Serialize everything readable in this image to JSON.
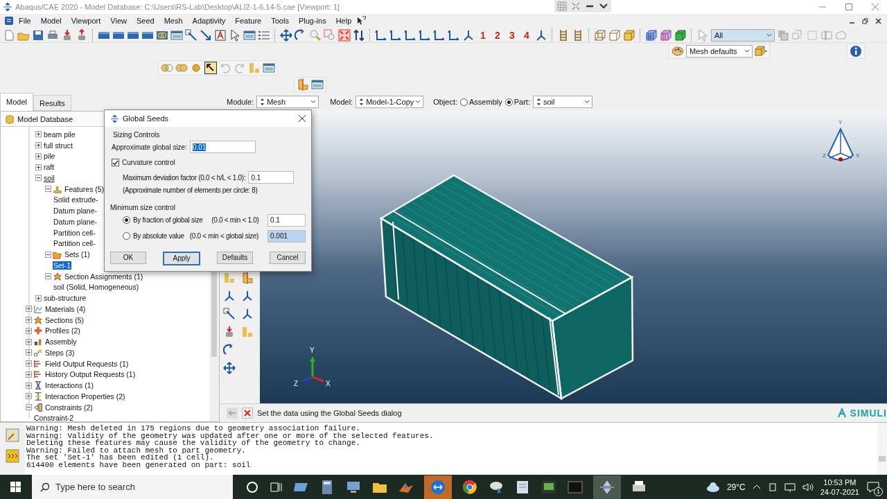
{
  "window": {
    "title": "Abaqus/CAE 2020 - Model Database: C:\\Users\\RS-Lab\\Desktop\\ALI2-1-6.14-5.cae [Viewport: 1]"
  },
  "menu": [
    "File",
    "Model",
    "Viewport",
    "View",
    "Seed",
    "Mesh",
    "Adaptivity",
    "Feature",
    "Tools",
    "Plug-ins",
    "Help"
  ],
  "toolbar": {
    "view_numbers": [
      "1",
      "2",
      "3",
      "4"
    ],
    "selection_filter": "All",
    "render_style": "Mesh defaults"
  },
  "tabs": [
    {
      "label": "Model",
      "selected": true
    },
    {
      "label": "Results",
      "selected": false
    }
  ],
  "context": {
    "module_label": "Module:",
    "module": "Mesh",
    "model_label": "Model:",
    "model": "Model-1-Copy",
    "object_label": "Object:",
    "objects": [
      {
        "label": "Assembly",
        "selected": false
      },
      {
        "label": "Part:",
        "selected": true
      }
    ],
    "part": "soil"
  },
  "tree": {
    "root": "Model Database",
    "part_items": [
      {
        "label": "beam pile",
        "expanded": false,
        "selected": false,
        "current": false
      },
      {
        "label": "full struct",
        "expanded": false,
        "selected": false,
        "current": false
      },
      {
        "label": "pile",
        "expanded": false,
        "selected": false,
        "current": false
      },
      {
        "label": "raft",
        "expanded": false,
        "selected": false,
        "current": false
      },
      {
        "label": "soil",
        "expanded": true,
        "selected": false,
        "current": true,
        "children": [
          {
            "label": "Features (5)",
            "kind": "feature",
            "expanded": true,
            "selected": false,
            "children": [
              {
                "label": "Solid extrude-",
                "selected": false
              },
              {
                "label": "Datum plane-",
                "selected": false
              },
              {
                "label": "Datum plane-",
                "selected": false
              },
              {
                "label": "Partition cell-",
                "selected": false
              },
              {
                "label": "Partition cell-",
                "selected": false
              }
            ]
          },
          {
            "label": "Sets (1)",
            "kind": "set",
            "expanded": true,
            "selected": false,
            "children": [
              {
                "label": "Set-1",
                "selected": true
              }
            ]
          },
          {
            "label": "Section Assignments (1)",
            "kind": "assignment",
            "expanded": true,
            "selected": false,
            "children": [
              {
                "label": "soil (Solid, Homogeneous)",
                "selected": false
              }
            ]
          }
        ]
      },
      {
        "label": "sub-structure",
        "expanded": false,
        "selected": false,
        "current": false
      }
    ],
    "model_items": [
      {
        "label": "Materials (4)",
        "kind": "material",
        "expanded": false,
        "selected": false
      },
      {
        "label": "Sections (5)",
        "kind": "section",
        "expanded": false,
        "selected": false
      },
      {
        "label": "Profiles (2)",
        "kind": "profile",
        "expanded": false,
        "selected": false
      },
      {
        "label": "Assembly",
        "kind": "assembly",
        "expanded": false,
        "selected": false
      },
      {
        "label": "Steps (3)",
        "kind": "step",
        "expanded": false,
        "selected": false
      },
      {
        "label": "Field Output Requests (1)",
        "kind": "output",
        "expanded": false,
        "selected": false
      },
      {
        "label": "History Output Requests (1)",
        "kind": "output",
        "expanded": false,
        "selected": false
      },
      {
        "label": "Interactions (1)",
        "kind": "interaction",
        "expanded": false,
        "selected": false
      },
      {
        "label": "Interaction Properties (2)",
        "kind": "property",
        "expanded": false,
        "selected": false
      },
      {
        "label": "Constraints (2)",
        "kind": "constraint",
        "expanded": true,
        "selected": false,
        "children": [
          {
            "label": "Constraint-2",
            "selected": false
          }
        ]
      }
    ]
  },
  "dialog": {
    "title": "Global Seeds",
    "group": "Sizing Controls",
    "global_size_label": "Approximate global size:",
    "global_size": "0.01",
    "curvature": {
      "label": "Curvature control",
      "checked": true
    },
    "deviation_label": "Maximum deviation factor (0.0 < h/L < 1.0):",
    "deviation": "0.1",
    "elements_note": "(Approximate number of elements per circle: 8)",
    "min_size_title": "Minimum size control",
    "min_options": [
      {
        "label": "By fraction of global size",
        "range": "(0.0 < min < 1.0)",
        "value": "0.1",
        "selected": true
      },
      {
        "label": "By absolute value",
        "range": "(0.0 < min < global size)",
        "value": "0.001",
        "selected": false
      }
    ],
    "buttons": [
      {
        "label": "OK",
        "default": false
      },
      {
        "label": "Apply",
        "default": true
      },
      {
        "label": "Defaults",
        "default": false
      },
      {
        "label": "Cancel",
        "default": false
      }
    ]
  },
  "viewport": {
    "triad_labels": [
      "Y",
      "Z",
      "X"
    ],
    "orientation_labels": [
      "Y",
      "Z",
      "X"
    ],
    "logo": "SIMULI"
  },
  "prompt": "Set the data using the Global Seeds dialog",
  "messages": [
    "Warning: Mesh deleted in 175 regions due to geometry association failure.",
    "Warning: Validity of the geometry was updated after one or more of the selected features.",
    "Deleting these features may cause the validity of the geometry to change.",
    "Warning: Failed to attach mesh to part geometry.",
    "The set 'Set-1' has been edited (1 cell).",
    "614400 elements have been generated on part: soil"
  ],
  "taskbar": {
    "search_placeholder": "Type here to search",
    "temperature": "29°C",
    "time": "10:53 PM",
    "date": "24-07-2021",
    "notifications": "1"
  }
}
